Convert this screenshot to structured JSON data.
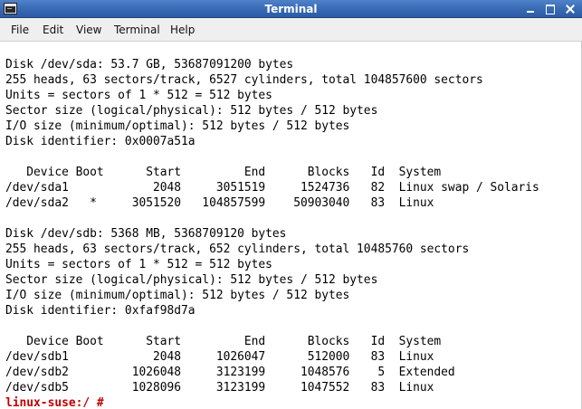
{
  "window": {
    "title": "Terminal",
    "icon": "terminal-icon"
  },
  "menubar": {
    "items": [
      "File",
      "Edit",
      "View",
      "Terminal",
      "Help"
    ]
  },
  "terminal": {
    "lines": [
      "Disk /dev/sda: 53.7 GB, 53687091200 bytes",
      "255 heads, 63 sectors/track, 6527 cylinders, total 104857600 sectors",
      "Units = sectors of 1 * 512 = 512 bytes",
      "Sector size (logical/physical): 512 bytes / 512 bytes",
      "I/O size (minimum/optimal): 512 bytes / 512 bytes",
      "Disk identifier: 0x0007a51a",
      "",
      "   Device Boot      Start         End      Blocks   Id  System",
      "/dev/sda1            2048     3051519     1524736   82  Linux swap / Solaris",
      "/dev/sda2   *     3051520   104857599    50903040   83  Linux",
      "",
      "Disk /dev/sdb: 5368 MB, 5368709120 bytes",
      "255 heads, 63 sectors/track, 652 cylinders, total 10485760 sectors",
      "Units = sectors of 1 * 512 = 512 bytes",
      "Sector size (logical/physical): 512 bytes / 512 bytes",
      "I/O size (minimum/optimal): 512 bytes / 512 bytes",
      "Disk identifier: 0xfaf98d7a",
      "",
      "   Device Boot      Start         End      Blocks   Id  System",
      "/dev/sdb1            2048     1026047      512000   83  Linux",
      "/dev/sdb2         1026048     3123199     1048576    5  Extended",
      "/dev/sdb5         1028096     3123199     1047552   83  Linux"
    ],
    "prompt": "linux-suse:/ #"
  },
  "colors": {
    "titlebar": "#3a6db7",
    "prompt": "#c00000",
    "background": "#ffffff"
  }
}
